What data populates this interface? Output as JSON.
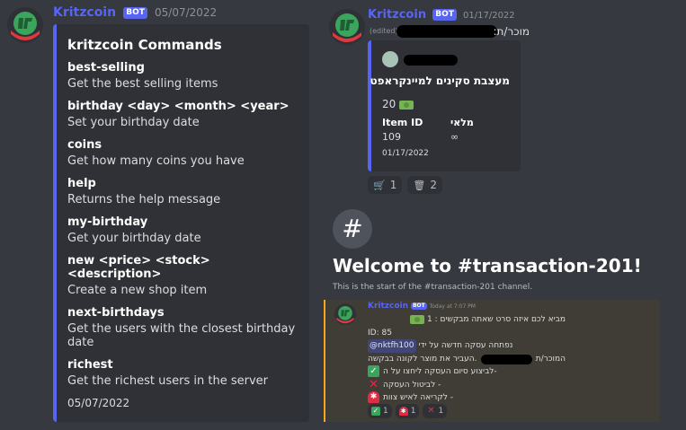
{
  "left_message": {
    "author": "Kritzcoin",
    "bot_tag": "BOT",
    "timestamp": "05/07/2022",
    "embed": {
      "title": "kritzcoin Commands",
      "commands": [
        {
          "name": "best-selling",
          "desc": "Get the best selling items"
        },
        {
          "name": "birthday <day> <month> <year>",
          "desc": "Set your birthday date"
        },
        {
          "name": "coins",
          "desc": "Get how many coins you have"
        },
        {
          "name": "help",
          "desc": "Returns the help message"
        },
        {
          "name": "my-birthday",
          "desc": "Get your birthday date"
        },
        {
          "name": "new <price> <stock> <description>",
          "desc": "Create a new shop item"
        },
        {
          "name": "next-birthdays",
          "desc": "Get the users with the closest birthday date"
        },
        {
          "name": "richest",
          "desc": "Get the richest users in the server"
        }
      ],
      "footer": "05/07/2022"
    }
  },
  "right_message": {
    "author": "Kritzcoin",
    "bot_tag": "BOT",
    "timestamp": "01/17/2022",
    "edited": "(edited)",
    "seller_prefix": "מוכר/ת:",
    "embed": {
      "title": "מעצבת סקינים למיינקראפט",
      "price": "20",
      "fields": [
        {
          "name": "Item ID",
          "value": "109"
        },
        {
          "name": "מלאי",
          "value": "∞"
        }
      ],
      "footer": "01/17/2022"
    },
    "reactions": [
      {
        "icon": "cart-icon",
        "count": "1"
      },
      {
        "icon": "wastebasket-icon",
        "count": "2"
      }
    ]
  },
  "channel_intro": {
    "icon": "#",
    "title": "Welcome to #transaction-201!",
    "subtitle": "This is the start of the #transaction-201 channel."
  },
  "transaction_message": {
    "author": "Kritzcoin",
    "bot_tag": "BOT",
    "timestamp": "Today at 7:07 PM",
    "lines": {
      "line1": "מביא לכם איזה סרט שאתה מבקשים : 1",
      "line2": "ID: 85",
      "line3_text": "נפתחה עסקה חדשה על ידי",
      "line3_mention": "@nktfh100",
      "line4_prefix": "המוכר/ת",
      "line4_suffix": "העביר את מוצר לקונה בבקשה.",
      "line5": "לביצוע סיום העסקה ליחצו על ה-",
      "line6": "לביטול העסקה -",
      "line7": "לקריאה לאיש צוות -"
    },
    "reactions": [
      {
        "icon": "check-mark-icon",
        "count": "1"
      },
      {
        "icon": "siren-icon",
        "count": "1"
      },
      {
        "icon": "x-mark-icon",
        "count": "1"
      }
    ]
  },
  "colors": {
    "background": "#36393f",
    "embed_bg": "#2f3136",
    "blurple": "#5865f2",
    "highlight_bg": "#3f3d35",
    "highlight_bar": "#faa61a"
  }
}
